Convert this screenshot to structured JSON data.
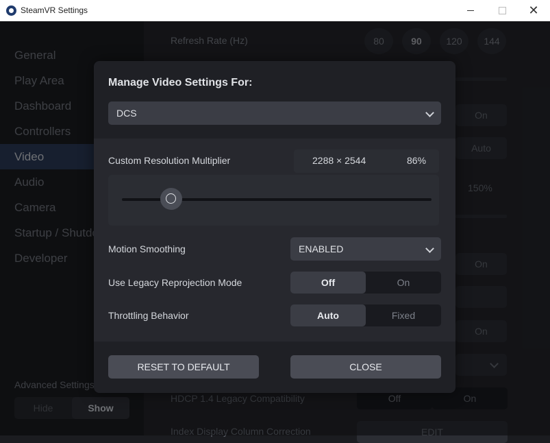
{
  "window": {
    "title": "SteamVR Settings",
    "icon": "steamvr-icon"
  },
  "sidebar": {
    "items": [
      {
        "label": "General",
        "active": false
      },
      {
        "label": "Play Area",
        "active": false
      },
      {
        "label": "Dashboard",
        "active": false
      },
      {
        "label": "Controllers",
        "active": false
      },
      {
        "label": "Video",
        "active": true
      },
      {
        "label": "Audio",
        "active": false
      },
      {
        "label": "Camera",
        "active": false
      },
      {
        "label": "Startup / Shutdown",
        "active": false
      },
      {
        "label": "Developer",
        "active": false
      }
    ],
    "advanced_label": "Advanced Settings",
    "advanced_hide": "Hide",
    "advanced_show": "Show",
    "advanced_selected": "Show"
  },
  "background": {
    "refresh_rate_label": "Refresh Rate (Hz)",
    "refresh_rates": [
      "80",
      "90",
      "120",
      "144"
    ],
    "refresh_rate_selected": "90",
    "on_1": "On",
    "auto": "Auto",
    "percent": "150%",
    "on_2": "On",
    "on_3": "On",
    "hdcp_label": "HDCP 1.4 Legacy Compatibility",
    "hdcp_off": "Off",
    "hdcp_on": "On",
    "index_label": "Index Display Column Correction",
    "edit": "EDIT"
  },
  "dialog": {
    "title": "Manage Video Settings For:",
    "app_select": "DCS",
    "resolution_label": "Custom Resolution Multiplier",
    "resolution_value": "2288 × 2544",
    "resolution_percent": "86%",
    "resolution_fraction": 0.16,
    "motion_label": "Motion Smoothing",
    "motion_value": "ENABLED",
    "legacy_label": "Use Legacy Reprojection Mode",
    "legacy_off": "Off",
    "legacy_on": "On",
    "legacy_selected": "Off",
    "throttle_label": "Throttling Behavior",
    "throttle_auto": "Auto",
    "throttle_fixed": "Fixed",
    "throttle_selected": "Auto",
    "reset_button": "RESET TO DEFAULT",
    "close_button": "CLOSE"
  }
}
